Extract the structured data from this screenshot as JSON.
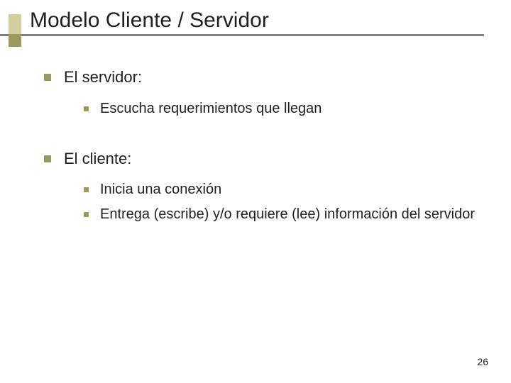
{
  "title": "Modelo Cliente / Servidor",
  "sections": [
    {
      "heading": "El servidor:",
      "items": [
        "Escucha requerimientos que llegan"
      ]
    },
    {
      "heading": "El cliente:",
      "items": [
        "Inicia una conexión",
        "Entrega (escribe) y/o requiere (lee) información del servidor"
      ]
    }
  ],
  "page_number": "26"
}
